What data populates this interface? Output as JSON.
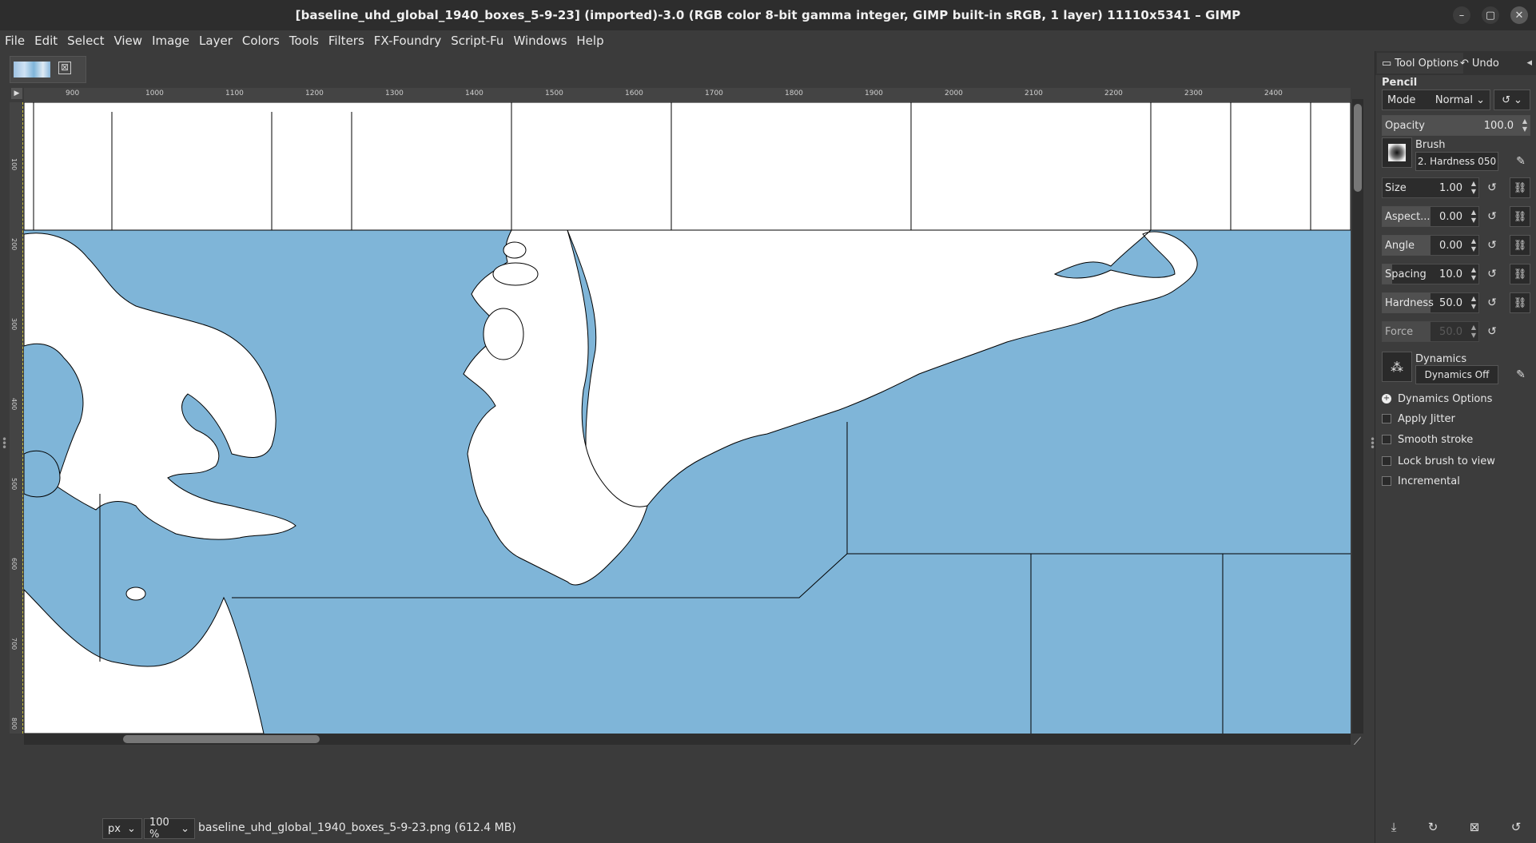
{
  "window": {
    "title": "[baseline_uhd_global_1940_boxes_5-9-23] (imported)-3.0 (RGB color 8-bit gamma integer, GIMP built-in sRGB, 1 layer) 11110x5341 – GIMP",
    "min_icon": "–",
    "max_icon": "▢",
    "close_icon": "✕"
  },
  "menu": [
    "File",
    "Edit",
    "Select",
    "View",
    "Image",
    "Layer",
    "Colors",
    "Tools",
    "Filters",
    "FX-Foundry",
    "Script-Fu",
    "Windows",
    "Help"
  ],
  "tabs": [
    {
      "close_icon": "⊠"
    }
  ],
  "ruler": {
    "h_ticks": [
      "900",
      "1000",
      "1100",
      "1200",
      "1300",
      "1400",
      "1500",
      "1600",
      "1700",
      "1800",
      "1900",
      "2000",
      "2100",
      "2200",
      "2300",
      "2400"
    ],
    "v_ticks": [
      "100",
      "200",
      "300",
      "400",
      "500",
      "600",
      "700",
      "800"
    ]
  },
  "status": {
    "unit": "px",
    "zoom": "100 %",
    "file_info": "baseline_uhd_global_1940_boxes_5-9-23.png (612.4 MB)"
  },
  "colors": {
    "water": "#7fb5d8",
    "land": "#ffffff",
    "boundary": "#000000"
  },
  "panel": {
    "tab_tool_options": "Tool Options",
    "tab_undo": "Undo",
    "tool_name": "Pencil",
    "mode_label": "Mode",
    "mode_value": "Normal",
    "opacity": {
      "label": "Opacity",
      "value": "100.0",
      "fraction": 1.0
    },
    "brush_label": "Brush",
    "brush_name": "2. Hardness 050",
    "size": {
      "label": "Size",
      "value": "1.00",
      "fraction": 0.0
    },
    "aspect": {
      "label": "Aspect...",
      "value": "0.00",
      "fraction": 0.5
    },
    "angle": {
      "label": "Angle",
      "value": "0.00",
      "fraction": 0.5
    },
    "spacing": {
      "label": "Spacing",
      "value": "10.0",
      "fraction": 0.1
    },
    "hardness": {
      "label": "Hardness",
      "value": "50.0",
      "fraction": 0.5
    },
    "force": {
      "label": "Force",
      "value": "50.0",
      "fraction": 0.5
    },
    "dynamics_label": "Dynamics",
    "dynamics_name": "Dynamics Off",
    "dynamics_options": "Dynamics Options",
    "apply_jitter": "Apply Jitter",
    "smooth_stroke": "Smooth stroke",
    "lock_brush": "Lock brush to view",
    "incremental": "Incremental"
  }
}
